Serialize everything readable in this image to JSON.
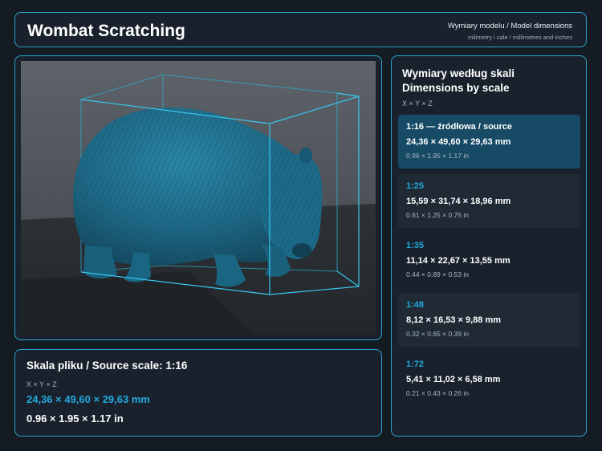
{
  "header": {
    "app_title": "Wombat Scratching",
    "title": "Wymiary modelu / Model dimensions",
    "subtitle": "milimetry i cale / millimetres and inches"
  },
  "source": {
    "scale_title": "Skala pliku / Source scale: 1:16",
    "axis_label": "X × Y × Z",
    "mm": "24,36 × 49,60 × 29,63 mm",
    "inches": "0.96 × 1.95 × 1.17 in"
  },
  "scales": {
    "title": "Wymiary według skali Dimensions by scale",
    "axis_label": "X × Y × Z",
    "items": [
      {
        "name": "1:16  —  źródłowa / source",
        "mm": "24,36 × 49,60 × 29,63 mm",
        "inches": "0.96 × 1.95 × 1.17 in"
      },
      {
        "name": "1:25",
        "mm": "15,59 × 31,74 × 18,96 mm",
        "inches": "0.61 × 1.25 × 0.75 in"
      },
      {
        "name": "1:35",
        "mm": "11,14 × 22,67 × 13,55 mm",
        "inches": "0.44 × 0.89 × 0.53 in"
      },
      {
        "name": "1:48",
        "mm": "8,12 × 16,53 × 9,88 mm",
        "inches": "0.32 × 0.65 × 0.39 in"
      },
      {
        "name": "1:72",
        "mm": "5,41 × 11,02 × 6,58 mm",
        "inches": "0.21 × 0.43 × 0.26 in"
      }
    ]
  },
  "colors": {
    "accent": "#2aa3cc",
    "highlight_text": "#22a8dd",
    "active_card": "#174a65",
    "model": "#1f6f8c"
  },
  "viewer": {
    "model_icon": "wombat-3d-model"
  }
}
